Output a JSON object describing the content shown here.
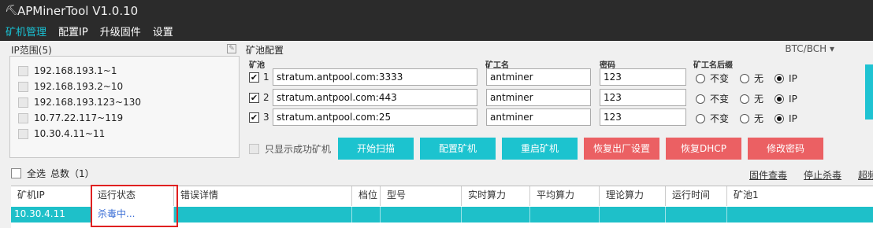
{
  "app": {
    "title": "APMinerTool V1.0.10",
    "icon": "pickaxe-icon"
  },
  "menu": [
    "矿机管理",
    "配置IP",
    "升级固件",
    "设置"
  ],
  "ip_panel": {
    "title": "IP范围(5)",
    "items": [
      "192.168.193.1~1",
      "192.168.193.2~10",
      "192.168.193.123~130",
      "10.77.22.117~119",
      "10.30.4.11~11"
    ]
  },
  "pool_panel": {
    "title": "矿池配置",
    "coin": "BTC/BCH",
    "col_pool": "矿池",
    "col_worker": "矿工名",
    "col_password": "密码",
    "col_suffix": "矿工名后缀",
    "rows": [
      {
        "num": "1",
        "pool": "stratum.antpool.com:3333",
        "worker": "antminer",
        "password": "123"
      },
      {
        "num": "2",
        "pool": "stratum.antpool.com:443",
        "worker": "antminer",
        "password": "123"
      },
      {
        "num": "3",
        "pool": "stratum.antpool.com:25",
        "worker": "antminer",
        "password": "123"
      }
    ],
    "suffix_options": [
      "不变",
      "无",
      "IP"
    ],
    "suffix_selected": "IP",
    "only_success": "只显示成功矿机",
    "buttons": {
      "scan": "开始扫描",
      "config": "配置矿机",
      "reboot": "重启矿机",
      "factory": "恢复出厂设置",
      "dhcp": "恢复DHCP",
      "password": "修改密码"
    }
  },
  "summary": {
    "select_all": "全选",
    "total": "总数（1）"
  },
  "links": [
    "固件查毒",
    "停止杀毒",
    "超频"
  ],
  "grid": {
    "headers": [
      "矿机IP",
      "运行状态",
      "错误详情",
      "档位",
      "型号",
      "实时算力",
      "平均算力",
      "理论算力",
      "运行时间",
      "矿池1"
    ],
    "rows": [
      {
        "ip": "10.30.4.11",
        "status": "杀毒中..."
      }
    ]
  },
  "colors": {
    "accent": "#1cc3cf",
    "danger": "#eb6063",
    "titlebar": "#2b2b2b"
  }
}
